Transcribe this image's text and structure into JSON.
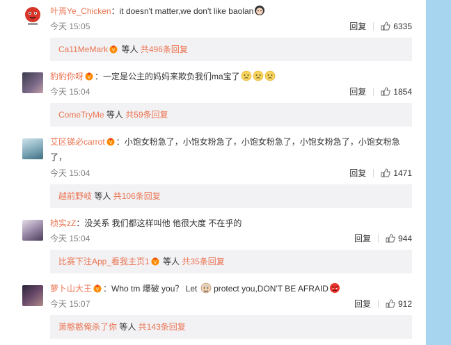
{
  "comments": [
    {
      "username": "叶焉Ye_Chicken",
      "text": "：it doesn't matter,we don't like baolan",
      "time": "今天 15:05",
      "reply_label": "回复",
      "likes": "6335",
      "replies": {
        "user": "Ca11MeMark",
        "mid": "等人",
        "count": "共496条回复"
      }
    },
    {
      "username": "豹豹你呀",
      "text": "：一定是公主的妈妈来欺负我们ma宝了",
      "time": "今天 15:04",
      "reply_label": "回复",
      "likes": "1854",
      "replies": {
        "user": "ComeTryMe",
        "mid": "等人",
        "count": "共59条回复"
      }
    },
    {
      "username": "艾区锑必carrot",
      "text": "：小饱女粉急了，小饱女粉急了，小饱女粉急了，小饱女粉急了，小饱女粉急了，",
      "time": "今天 15:04",
      "reply_label": "回复",
      "likes": "1471",
      "replies": {
        "user": "越前野岐",
        "mid": "等人",
        "count": "共106条回复"
      }
    },
    {
      "username": "桢实zZ",
      "text": "：没关系 我们都这样叫他 他很大度 不在乎的",
      "time": "今天 15:04",
      "reply_label": "回复",
      "likes": "944",
      "replies": {
        "user": "比赛下注App_看我主页1",
        "mid": "等人",
        "count": "共35条回复"
      }
    },
    {
      "username": "萝卜山大王",
      "text_a": "：Who tm 爆破 you？ Let",
      "text_b": "protect you,DON'T BE AFRAID",
      "time": "今天 15:07",
      "reply_label": "回复",
      "likes": "912",
      "replies": {
        "user": "萧憨憨俺杀了你",
        "mid": "等人",
        "count": "共143条回复"
      }
    }
  ],
  "colors": {
    "accent": "#eb7350",
    "background": "#a7d4ef",
    "subbox": "#f2f2f5"
  }
}
